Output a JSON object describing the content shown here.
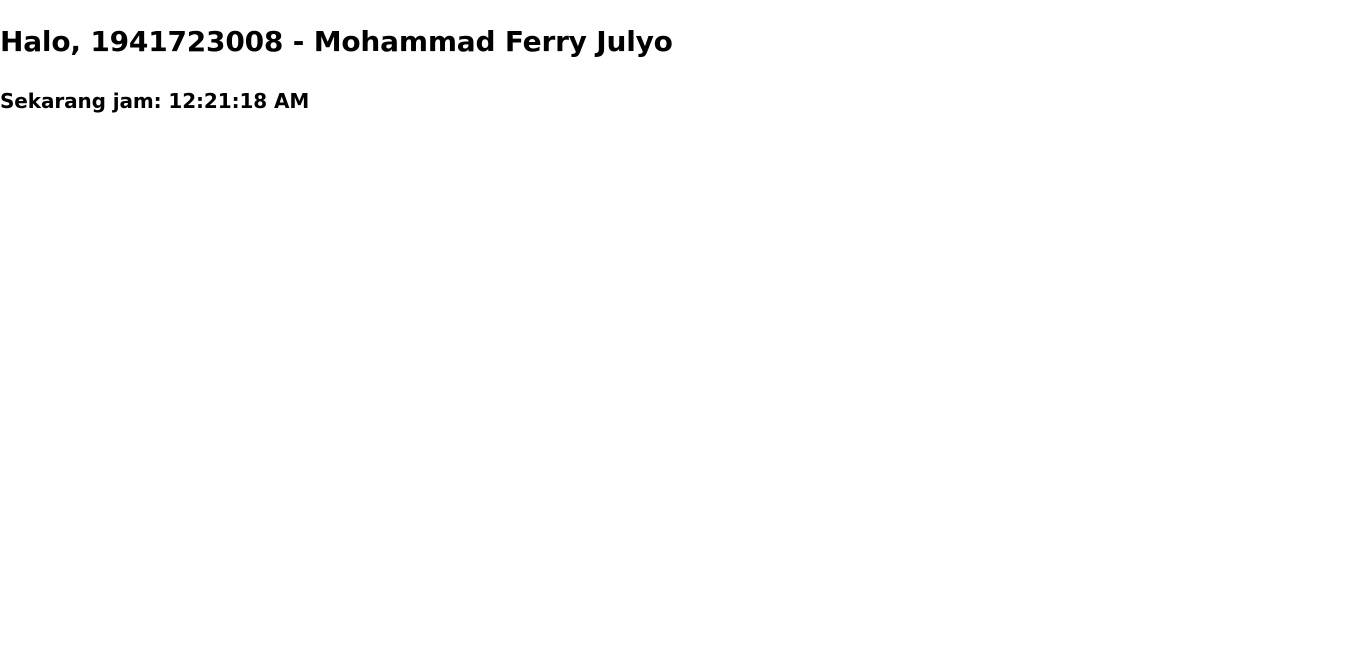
{
  "greeting": {
    "prefix": "Halo, ",
    "user_id": "1941723008",
    "separator": " - ",
    "user_name": "Mohammad Ferry Julyo"
  },
  "clock": {
    "label": "Sekarang jam: ",
    "time": "12:21:18 AM"
  }
}
